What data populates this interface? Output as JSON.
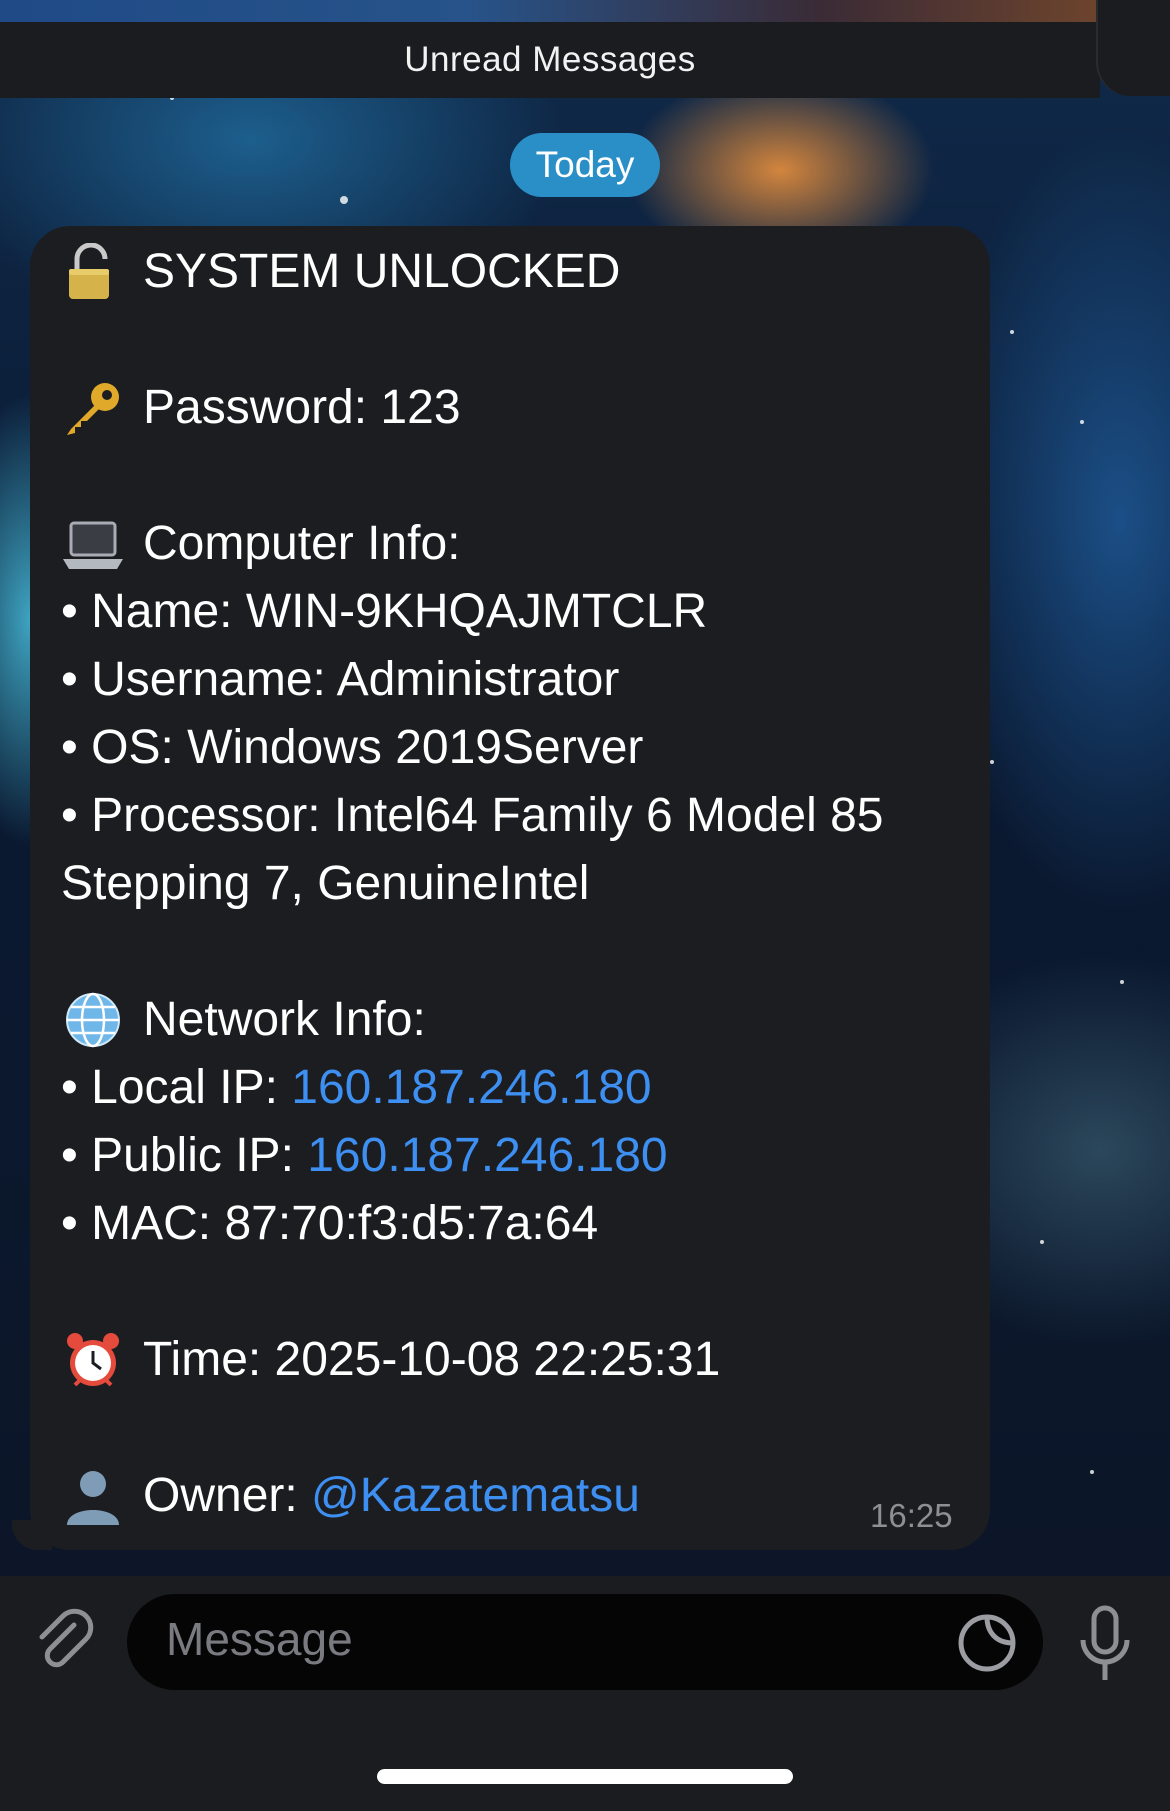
{
  "header": {
    "title": "Unread Messages"
  },
  "date_separator": "Today",
  "message": {
    "title": "SYSTEM UNLOCKED",
    "title_icon": "lock-open-icon",
    "password_line": "Password: 123",
    "password_icon": "key-icon",
    "computer_header": "Computer Info:",
    "computer_icon": "laptop-icon",
    "name_line": "• Name: WIN-9KHQAJMTCLR",
    "username_line": "• Username: Administrator",
    "os_line": "• OS: Windows 2019Server",
    "processor_line_1": "• Processor: Intel64 Family 6 Model 85",
    "processor_line_2": "Stepping 7, GenuineIntel",
    "network_header": "Network Info:",
    "network_icon": "globe-icon",
    "local_ip_label": "• Local IP: ",
    "local_ip": "160.187.246.180",
    "public_ip_label": "• Public IP: ",
    "public_ip": "160.187.246.180",
    "mac_line": "• MAC: 87:70:f3:d5:7a:64",
    "time_line": "Time: 2025-10-08 22:25:31",
    "time_icon": "alarm-clock-icon",
    "owner_label": "Owner: ",
    "owner_handle": "@Kazatematsu",
    "owner_icon": "user-silhouette-icon",
    "sent_time": "16:25"
  },
  "composer": {
    "placeholder": "Message",
    "attach_icon": "paperclip-icon",
    "sticker_icon": "sticker-icon",
    "mic_icon": "microphone-icon"
  },
  "colors": {
    "bubble": "#1c1d20",
    "link": "#3d8ff2",
    "date_pill": "#2b8fc7",
    "bar": "#1b1c1f"
  }
}
